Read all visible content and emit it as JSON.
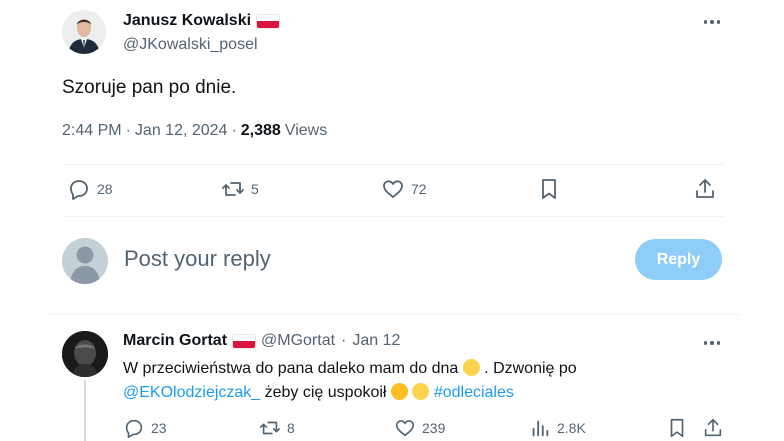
{
  "tweet": {
    "author_name": "Janusz Kowalski",
    "author_handle": "@JKowalski_posel",
    "text": "Szoruje pan po dnie.",
    "time": "2:44 PM",
    "date": "Jan 12, 2024",
    "views_count": "2,388",
    "views_label": "Views",
    "actions": {
      "replies": "28",
      "retweets": "5",
      "likes": "72"
    }
  },
  "composer": {
    "placeholder": "Post your reply",
    "button_label": "Reply"
  },
  "reply": {
    "author_name": "Marcin Gortat",
    "author_handle": "@MGortat",
    "date": "Jan 12",
    "text_part1": "W przeciwieństwa do pana daleko mam do dna ",
    "text_part2": " . Dzwonię po",
    "mention": "@EKOlodziejczak_",
    "text_part3": " żeby cię uspokoił ",
    "hashtag": "#odleciales",
    "actions": {
      "replies": "23",
      "retweets": "8",
      "likes": "239",
      "views": "2.8K"
    }
  },
  "colors": {
    "accent": "#1d9bf0",
    "reply_button": "#8ecdf8",
    "secondary_text": "#536471",
    "divider": "#eff3f4"
  },
  "icons": [
    "person-avatar",
    "more-dots-icon",
    "reply-icon",
    "retweet-icon",
    "like-icon",
    "bookmark-icon",
    "share-icon",
    "views-icon",
    "poland-flag-icon",
    "finger-emoji-icon",
    "sweat-smile-emoji-icon"
  ]
}
